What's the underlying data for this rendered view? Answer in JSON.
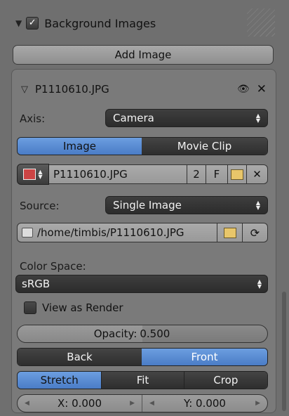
{
  "panel": {
    "title": "Background Images",
    "add_button": "Add Image"
  },
  "image_item": {
    "name": "P1110610.JPG",
    "axis_label": "Axis:",
    "axis_value": "Camera",
    "tabs": [
      "Image",
      "Movie Clip"
    ],
    "active_tab": "Image",
    "datablock_name": "P1110610.JPG",
    "users_count": "2",
    "fake_user": "F",
    "source_label": "Source:",
    "source_value": "Single Image",
    "filepath": "/home/timbis/P1110610.JPG",
    "color_space_label": "Color Space:",
    "color_space_value": "sRGB",
    "view_as_render_label": "View as Render",
    "opacity_label": "Opacity:",
    "opacity_value": "0.500",
    "depth_options": [
      "Back",
      "Front"
    ],
    "depth_active": "Front",
    "frame_methods": [
      "Stretch",
      "Fit",
      "Crop"
    ],
    "frame_active": "Stretch",
    "offset_x": "X: 0.000",
    "offset_y": "Y: 0.000"
  },
  "colors": {
    "accent_blue": "#5a8bd6",
    "panel_bg": "#6f6f6f",
    "dark_field": "#353535"
  }
}
